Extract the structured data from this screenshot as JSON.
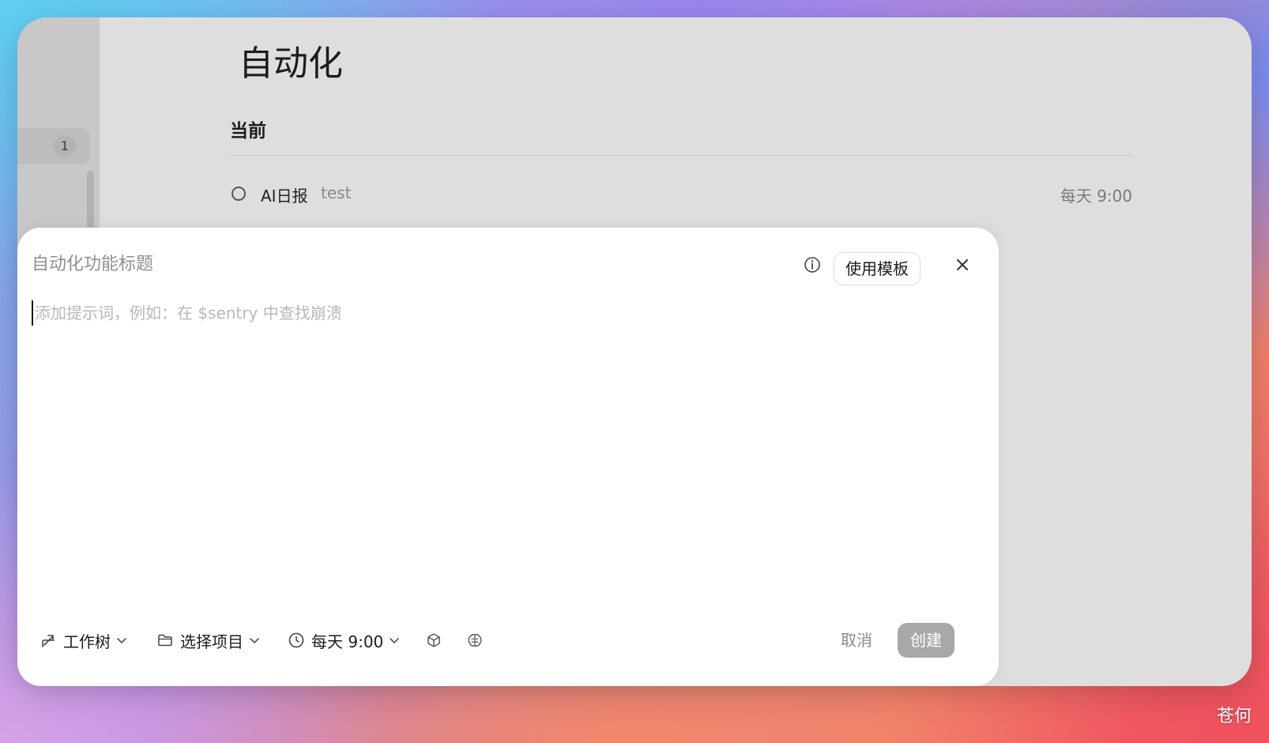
{
  "sidebar": {
    "badge_count": "1"
  },
  "page": {
    "title": "自动化",
    "section_title": "当前"
  },
  "automations": [
    {
      "name": "AI日报",
      "description": "test",
      "schedule": "每天 9:00"
    }
  ],
  "dialog": {
    "title_placeholder": "自动化功能标题",
    "template_label": "使用模板",
    "prompt_placeholder": "添加提示词，例如：在 $sentry 中查找崩溃",
    "toolbar": {
      "worktree_label": "工作树",
      "project_label": "选择项目",
      "schedule_label": "每天 9:00",
      "cancel_label": "取消",
      "create_label": "创建"
    }
  },
  "watermark": "苍何",
  "colors": {
    "create_button_disabled": "#a8a8a8",
    "window_background": "#dedede",
    "dialog_background": "#ffffff"
  }
}
